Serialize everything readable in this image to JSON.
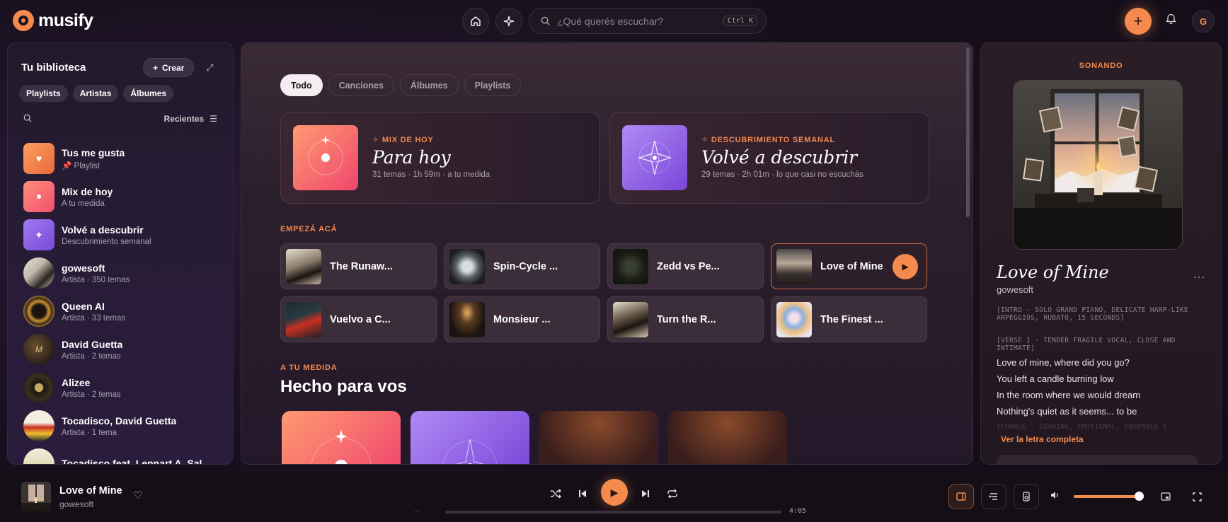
{
  "app": {
    "logo_text": "musify",
    "search_placeholder": "¿Qué querés escuchar?",
    "search_shortcut": "Ctrl K",
    "user_initial": "G",
    "accent": "#f58a4e"
  },
  "sidebar": {
    "title": "Tu biblioteca",
    "create_label": "Crear",
    "filters": [
      "Playlists",
      "Artistas",
      "Álbumes"
    ],
    "sort_label": "Recientes",
    "items": [
      {
        "name": "Tus me gusta",
        "sub": "Playlist",
        "pinned": true
      },
      {
        "name": "Mix de hoy",
        "sub": "A tu medida"
      },
      {
        "name": "Volvé a descubrir",
        "sub": "Descubrimiento semanal"
      },
      {
        "name": "gowesoft",
        "sub": "Artista · 350 temas"
      },
      {
        "name": "Queen AI",
        "sub": "Artista · 33 temas"
      },
      {
        "name": "David Guetta",
        "sub": "Artista · 2 temas"
      },
      {
        "name": "Alizee",
        "sub": "Artista · 2 temas"
      },
      {
        "name": "Tocadisco, David Guetta",
        "sub": "Artista · 1 tema"
      },
      {
        "name": "Tocadisco feat. Lennart A. Sal...",
        "sub": ""
      }
    ]
  },
  "main": {
    "tabs": [
      "Todo",
      "Canciones",
      "Álbumes",
      "Playlists"
    ],
    "active_tab": "Todo",
    "mixes": [
      {
        "tag": "MIX DE HOY",
        "title": "Para hoy",
        "meta": "31 temas · 1h 59m · a tu medida"
      },
      {
        "tag": "DESCUBRIMIENTO SEMANAL",
        "title": "Volvé a descubrir",
        "meta": "29 temas · 2h 01m · lo que casi no escuchás"
      }
    ],
    "start_label": "EMPEZÁ ACÁ",
    "quick": [
      {
        "label": "The Runaw..."
      },
      {
        "label": "Spin-Cycle ..."
      },
      {
        "label": "Zedd vs Pe..."
      },
      {
        "label": "Love of Mine"
      },
      {
        "label": "Vuelvo a C..."
      },
      {
        "label": "Monsieur ..."
      },
      {
        "label": "Turn the R..."
      },
      {
        "label": "The Finest ..."
      }
    ],
    "made_label": "A TU MEDIDA",
    "made_title": "Hecho para vos"
  },
  "now_playing": {
    "header": "SONANDO",
    "title": "Love of Mine",
    "artist": "gowesoft",
    "tag1": "[INTRO - SOLO GRAND PIANO, DELICATE HARP-LIKE ARPEGGIOS, RUBATO, 15 SECONDS]",
    "tag2": "[VERSE 1 - TENDER FRAGILE VOCAL, CLOSE AND INTIMATE]",
    "lyrics": [
      "Love of mine, where did you go?",
      "You left a candle burning low",
      "In the room where we would dream",
      "Nothing's quiet as it seems... to be"
    ],
    "faded_line": "[CHORUS - SOARING, EMOTIONAL, ENSEMBLE S",
    "full_lyrics_link": "Ver la letra completa"
  },
  "player": {
    "title": "Love of Mine",
    "artist": "gowesoft",
    "elapsed": "--",
    "duration": "4:05",
    "progress": 0.0,
    "volume": 0.92
  }
}
